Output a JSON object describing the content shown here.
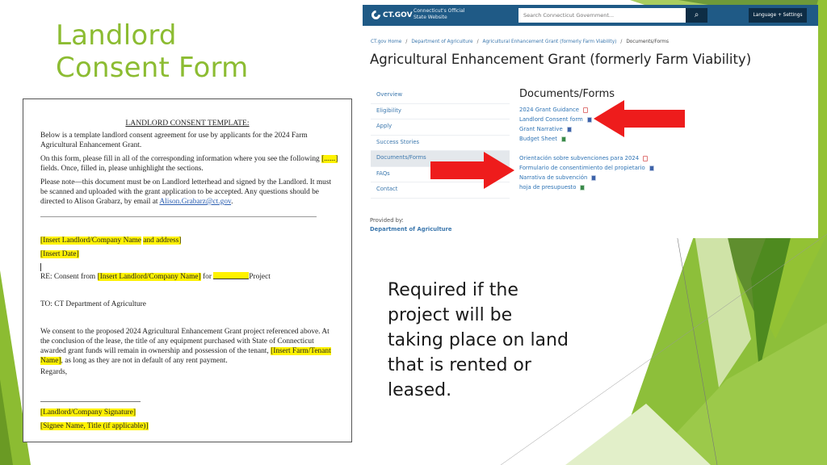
{
  "slide": {
    "title_line1": "Landlord",
    "title_line2": "Consent Form",
    "callout": "Required if the project will be taking place on land that is rented or leased.",
    "accent_color": "#8cbc32",
    "highlight_color": "#fff200",
    "arrow_color": "#ee1c1c"
  },
  "document": {
    "heading": "LANDLORD CONSENT TEMPLATE:",
    "intro": "Below is a template landlord consent agreement for use by applicants for the 2024 Farm Agricultural Enhancement Grant.",
    "fill_prefix": "On this form, please fill in all of the corresponding information where you see the following",
    "fill_marker": "[......]",
    "fill_suffix": " fields.  Once, filled in, please unhighlight the sections.",
    "note_text": "Please note—this document must be on Landlord letterhead and signed by the Landlord.  It must be scanned and uploaded with the grant application to be accepted.  Any questions should be directed to Alison Grabarz, by email at ",
    "note_email": "Alison.Grabarz@ct.gov",
    "note_end": ".",
    "landlord_name_field": "[Insert Landlord/Company Name",
    "address_field": "and address]",
    "date_field": "[Insert Date]",
    "re_prefix": "RE: Consent from ",
    "re_landlord_field": "[Insert Landlord/Company Name]",
    "re_for": " for ",
    "re_suffix": "Project",
    "to_line": "TO: CT Department of Agriculture",
    "consent_text": "We consent to the proposed 2024 Agricultural Enhancement Grant project referenced above.  At the conclusion of the lease, the title of any equipment purchased with State of Connecticut awarded grant funds will remain in ownership and possession of the tenant, ",
    "tenant_field": "[Insert Farm/Tenant Name]",
    "consent_end": ", as long as they are not in default of any rent payment.",
    "regards": "Regards,",
    "signature_field": "[Landlord/Company Signature]",
    "signee_field": "[Signee Name, Title (if applicable)]"
  },
  "website": {
    "logo_text": "CT.GOV",
    "logo_tagline_1": "Connecticut's Official",
    "logo_tagline_2": "State Website",
    "search_placeholder": "Search Connecticut Government...",
    "search_icon": "search-icon",
    "language_button": "Language + Settings",
    "breadcrumbs": [
      "CT.gov Home",
      "Department of Agriculture",
      "Agricultural Enhancement Grant (formerly Farm Viability)",
      "Documents/Forms"
    ],
    "page_title": "Agricultural Enhancement Grant (formerly Farm Viability)",
    "nav_items": [
      {
        "label": "Overview"
      },
      {
        "label": "Eligibility"
      },
      {
        "label": "Apply"
      },
      {
        "label": "Success Stories"
      },
      {
        "label": "Documents/Forms",
        "active": true
      },
      {
        "label": "FAQs"
      },
      {
        "label": "Contact"
      }
    ],
    "provided_by_label": "Provided by:",
    "provided_by_link": "Department of Agriculture",
    "section_title": "Documents/Forms",
    "documents_en": [
      {
        "label": "2024 Grant Guidance",
        "icon": "pdf"
      },
      {
        "label": "Landlord Consent form",
        "icon": "word"
      },
      {
        "label": "Grant Narrative",
        "icon": "word"
      },
      {
        "label": "Budget Sheet",
        "icon": "excel"
      }
    ],
    "documents_es": [
      {
        "label": "Orientación sobre subvenciones para 2024",
        "icon": "pdf"
      },
      {
        "label": "Formulario de consentimiento del propietario",
        "icon": "word"
      },
      {
        "label": "Narrativa de subvención",
        "icon": "word"
      },
      {
        "label": "hoja de presupuesto",
        "icon": "excel"
      }
    ]
  }
}
